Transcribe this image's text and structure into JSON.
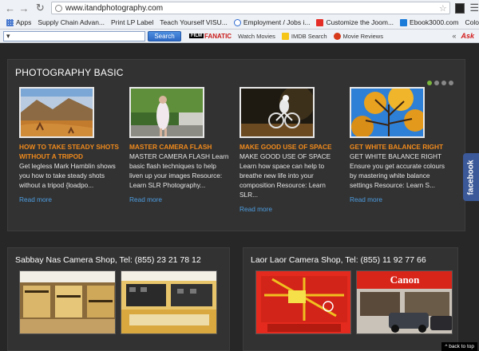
{
  "browser": {
    "url": "www.itandphotography.com",
    "bookmarks": [
      {
        "label": "Apps",
        "icon": "apps-icon"
      },
      {
        "label": "Supply Chain Advan...",
        "icon": "page-icon"
      },
      {
        "label": "Print LP Label",
        "icon": "page-icon"
      },
      {
        "label": "Teach Yourself VISU...",
        "icon": "page-icon"
      },
      {
        "label": "Employment / Jobs i...",
        "icon": "globe-icon"
      },
      {
        "label": "Customize the Joom...",
        "icon": "youtube-icon"
      },
      {
        "label": "Ebook3000.com",
        "icon": "ebook-icon"
      },
      {
        "label": "Colornames",
        "icon": "page-icon"
      }
    ],
    "bookmarks_more": "»"
  },
  "toolbar": {
    "search_value": "▾",
    "search_button": "Search",
    "logo_film": "FILM",
    "logo_fanatic": "FANATIC",
    "links": [
      {
        "label": "Watch Movies"
      },
      {
        "label": "IMDB Search"
      },
      {
        "label": "Movie Reviews"
      }
    ],
    "right_arrows": "«",
    "right_icon": "Ask"
  },
  "section": {
    "title": "PHOTOGRAPHY BASIC",
    "cards": [
      {
        "title": "HOW TO TAKE STEADY SHOTS WITHOUT A TRIPOD",
        "text": "Get legless Mark Hamblin shows you how to take steady shots without a tripod {loadpo...",
        "more": "Read more"
      },
      {
        "title": "MASTER CAMERA FLASH",
        "text": "MASTER CAMERA FLASH Learn basic flash techniques to help liven up your images Resource: Learn SLR Photography...",
        "more": "Read more"
      },
      {
        "title": "MAKE GOOD USE OF SPACE",
        "text": "MAKE GOOD USE OF SPACE Learn how space can help to breathe new life into your composition Resource: Learn SLR...",
        "more": "Read more"
      },
      {
        "title": "GET WHITE BALANCE RIGHT",
        "text": "GET WHITE BALANCE RIGHT Ensure you get accurate colours by mastering white balance settings Resource: Learn S...",
        "more": "Read more"
      }
    ]
  },
  "facebook_tab": "facebook",
  "shops": [
    {
      "title": "Sabbay Nas Camera Shop, Tel: (855) 23 21 78 12"
    },
    {
      "title": "Laor Laor Camera Shop, Tel: (855) 11 92 77 66"
    }
  ],
  "canon_sign": "Canon",
  "back_to_top": "^ back to top"
}
